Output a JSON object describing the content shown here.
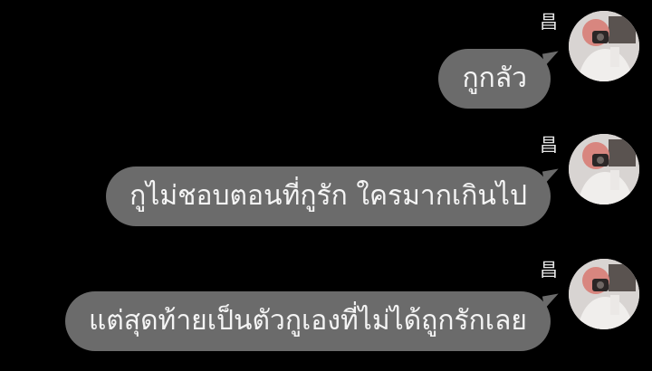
{
  "messages": [
    {
      "sender": "昌",
      "text": "กูกลัว"
    },
    {
      "sender": "昌",
      "text": "กูไม่ชอบตอนที่กูรัก ใครมากเกินไป"
    },
    {
      "sender": "昌",
      "text": "แต่สุดท้ายเป็นตัวกูเองที่ไม่ได้ถูกรักเลย"
    }
  ],
  "colors": {
    "background": "#000000",
    "bubble": "#6b6b6b",
    "bubble_text": "#f4f4f4",
    "sender_name": "#e6e6e6"
  },
  "icons": {
    "avatar": "profile-photo-avatar"
  }
}
